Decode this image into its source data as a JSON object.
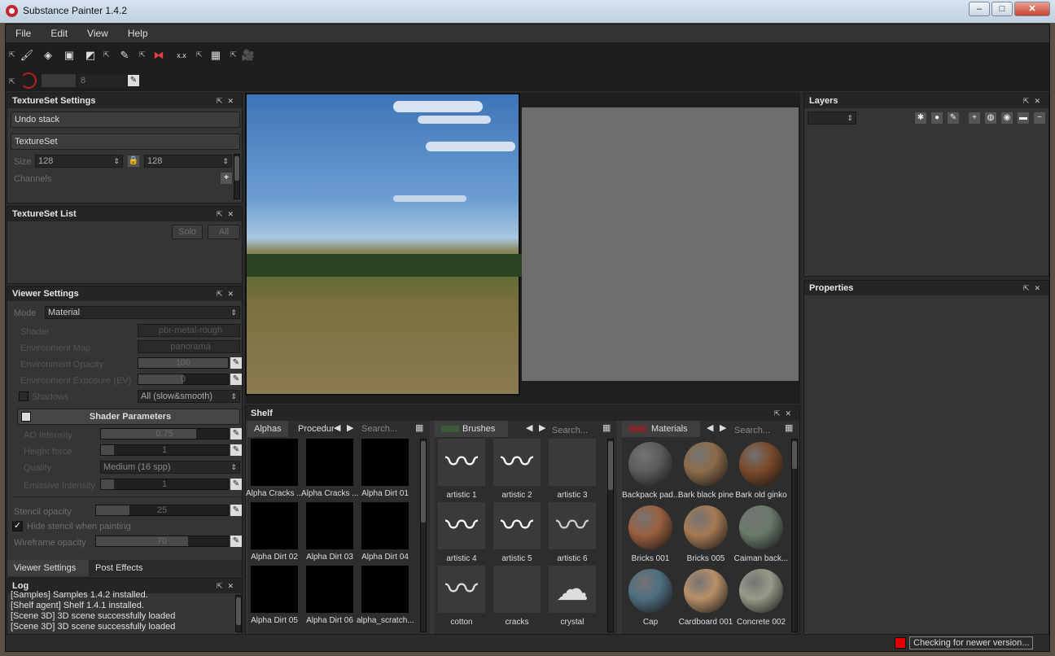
{
  "window": {
    "title": "Substance Painter 1.4.2",
    "buttons": [
      "–",
      "□",
      "✕"
    ]
  },
  "menu": [
    "File",
    "Edit",
    "View",
    "Help"
  ],
  "toolbar": {
    "brush_size": "8",
    "tools": [
      "paint-brush-icon",
      "eraser-icon",
      "projection-icon",
      "polygon-fill-icon",
      "smudge-icon",
      "clone-icon",
      "color-picker-icon",
      "symmetry-icon",
      "xyz-symmetry-icon",
      "camera-icon"
    ]
  },
  "textureset_settings": {
    "title": "TextureSet Settings",
    "undo_stack": "Undo stack",
    "textureset_name": "TextureSet",
    "size_label": "Size",
    "size_w": "128",
    "size_h": "128",
    "channels_label": "Channels"
  },
  "textureset_list": {
    "title": "TextureSet List",
    "solo": "Solo",
    "all": "All"
  },
  "viewer_settings": {
    "title": "Viewer Settings",
    "mode_label": "Mode",
    "mode_value": "Material",
    "shader_label": "Shader",
    "shader_value": "pbr-metal-rough",
    "env_map_label": "Environment Map",
    "env_map_value": "panorama",
    "env_opacity_label": "Environment Opacity",
    "env_opacity_value": "100",
    "env_exposure_label": "Environment Exposure (EV)",
    "env_exposure_value": "0",
    "shadows_label": "Shadows",
    "shadows_value": "All (slow&smooth)",
    "shader_params": "Shader Parameters",
    "ao_label": "AO Intensity",
    "ao_value": "0.75",
    "height_label": "Height force",
    "height_value": "1",
    "quality_label": "Quality",
    "quality_value": "Medium (16 spp)",
    "emissive_label": "Emissive Intensity",
    "emissive_value": "1",
    "stencil_label": "Stencil opacity",
    "stencil_value": "25",
    "hide_stencil": "Hide stencil when painting",
    "wireframe_label": "Wireframe opacity",
    "wireframe_value": "70",
    "tabs": [
      "Viewer Settings",
      "Post Effects"
    ]
  },
  "log": {
    "title": "Log",
    "lines": [
      "[Samples] Samples 1.4.2 installed.",
      "[Shelf agent] Shelf 1.4.1 installed.",
      "[Scene 3D] 3D scene successfully loaded",
      "[Scene 3D] 3D scene successfully loaded"
    ]
  },
  "layers": {
    "title": "Layers"
  },
  "properties": {
    "title": "Properties"
  },
  "shelf": {
    "title": "Shelf",
    "alphas": {
      "tabs": [
        "Alphas",
        "Procedur"
      ],
      "search": "Search...",
      "items": [
        "Alpha Cracks ...",
        "Alpha Cracks ...",
        "Alpha Dirt 01",
        "Alpha Dirt 02",
        "Alpha Dirt 03",
        "Alpha Dirt 04",
        "Alpha Dirt 05",
        "Alpha Dirt 06",
        "alpha_scratch..."
      ]
    },
    "brushes": {
      "tab": "Brushes",
      "search": "Search...",
      "items": [
        "artistic 1",
        "artistic 2",
        "artistic 3",
        "artistic 4",
        "artistic 5",
        "artistic 6",
        "cotton",
        "cracks",
        "crystal"
      ]
    },
    "materials": {
      "tab": "Materials",
      "search": "Search...",
      "items": [
        "Backpack pad...",
        "Bark black pine",
        "Bark old ginko",
        "Bricks 001",
        "Bricks 005",
        "Caiman back...",
        "Cap",
        "Cardboard 001",
        "Concrete 002"
      ],
      "colors": [
        "#5c5c5c",
        "#8b6b4a",
        "#7a4a2a",
        "#9a6040",
        "#a67a55",
        "#6a7a6a",
        "#4f6f80",
        "#b89068",
        "#9a9a8a"
      ]
    }
  },
  "status": {
    "text": "Checking for newer version..."
  }
}
